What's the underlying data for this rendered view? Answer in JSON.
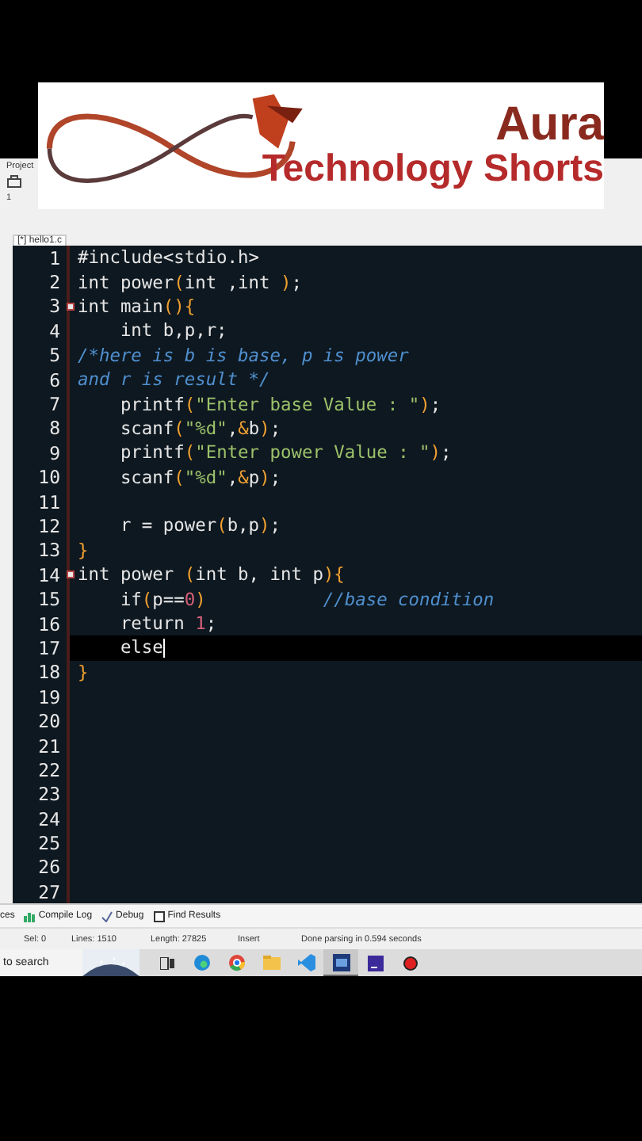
{
  "banner": {
    "title": "Aura",
    "subtitle": "Technology Shorts"
  },
  "ide": {
    "project_label": "Project",
    "panel_mark": "1",
    "file_tab": {
      "label": "[*] hello1.c",
      "selected": true
    }
  },
  "editor": {
    "lines": [
      {
        "number": "1",
        "fold": false,
        "current": false,
        "tokens": [
          {
            "kind": "plain",
            "text": "#include<stdio.h>"
          }
        ]
      },
      {
        "number": "2",
        "fold": false,
        "current": false,
        "tokens": [
          {
            "kind": "plain",
            "text": "int power"
          },
          {
            "kind": "paren",
            "text": "("
          },
          {
            "kind": "plain",
            "text": "int ,int "
          },
          {
            "kind": "paren",
            "text": ")"
          },
          {
            "kind": "plain",
            "text": ";"
          }
        ]
      },
      {
        "number": "3",
        "fold": true,
        "current": false,
        "tokens": [
          {
            "kind": "plain",
            "text": "int main"
          },
          {
            "kind": "paren",
            "text": "(){"
          }
        ]
      },
      {
        "number": "4",
        "fold": false,
        "current": false,
        "tokens": [
          {
            "kind": "plain",
            "text": "    int b,p,r;"
          }
        ]
      },
      {
        "number": "5",
        "fold": false,
        "current": false,
        "tokens": [
          {
            "kind": "comment",
            "text": "/*here is b is base, p is power"
          }
        ]
      },
      {
        "number": "6",
        "fold": false,
        "current": false,
        "tokens": [
          {
            "kind": "comment",
            "text": "and r is result */"
          }
        ]
      },
      {
        "number": "7",
        "fold": false,
        "current": false,
        "tokens": [
          {
            "kind": "plain",
            "text": "    printf"
          },
          {
            "kind": "paren",
            "text": "("
          },
          {
            "kind": "string",
            "text": "\"Enter base Value : \""
          },
          {
            "kind": "paren",
            "text": ")"
          },
          {
            "kind": "plain",
            "text": ";"
          }
        ]
      },
      {
        "number": "8",
        "fold": false,
        "current": false,
        "tokens": [
          {
            "kind": "plain",
            "text": "    scanf"
          },
          {
            "kind": "paren",
            "text": "("
          },
          {
            "kind": "string",
            "text": "\"%d\""
          },
          {
            "kind": "plain",
            "text": ","
          },
          {
            "kind": "paren",
            "text": "&"
          },
          {
            "kind": "plain",
            "text": "b"
          },
          {
            "kind": "paren",
            "text": ")"
          },
          {
            "kind": "plain",
            "text": ";"
          }
        ]
      },
      {
        "number": "9",
        "fold": false,
        "current": false,
        "tokens": [
          {
            "kind": "plain",
            "text": "    printf"
          },
          {
            "kind": "paren",
            "text": "("
          },
          {
            "kind": "string",
            "text": "\"Enter power Value : \""
          },
          {
            "kind": "paren",
            "text": ")"
          },
          {
            "kind": "plain",
            "text": ";"
          }
        ]
      },
      {
        "number": "10",
        "fold": false,
        "current": false,
        "tokens": [
          {
            "kind": "plain",
            "text": "    scanf"
          },
          {
            "kind": "paren",
            "text": "("
          },
          {
            "kind": "string",
            "text": "\"%d\""
          },
          {
            "kind": "plain",
            "text": ","
          },
          {
            "kind": "paren",
            "text": "&"
          },
          {
            "kind": "plain",
            "text": "p"
          },
          {
            "kind": "paren",
            "text": ")"
          },
          {
            "kind": "plain",
            "text": ";"
          }
        ]
      },
      {
        "number": "11",
        "fold": false,
        "current": false
      },
      {
        "number": "12",
        "fold": false,
        "current": false,
        "tokens": [
          {
            "kind": "plain",
            "text": "    r = power"
          },
          {
            "kind": "paren",
            "text": "("
          },
          {
            "kind": "plain",
            "text": "b,p"
          },
          {
            "kind": "paren",
            "text": ")"
          },
          {
            "kind": "plain",
            "text": ";"
          }
        ]
      },
      {
        "number": "13",
        "fold": false,
        "current": false,
        "tokens": [
          {
            "kind": "paren",
            "text": "}"
          }
        ]
      },
      {
        "number": "14",
        "fold": true,
        "current": false,
        "tokens": [
          {
            "kind": "plain",
            "text": "int power "
          },
          {
            "kind": "paren",
            "text": "("
          },
          {
            "kind": "plain",
            "text": "int b, int p"
          },
          {
            "kind": "paren",
            "text": "){"
          }
        ]
      },
      {
        "number": "15",
        "fold": false,
        "current": false,
        "tokens": [
          {
            "kind": "plain",
            "text": "    if"
          },
          {
            "kind": "paren",
            "text": "("
          },
          {
            "kind": "plain",
            "text": "p=="
          },
          {
            "kind": "number",
            "text": "0"
          },
          {
            "kind": "paren",
            "text": ")"
          },
          {
            "kind": "comment",
            "text": "//base condition"
          }
        ]
      },
      {
        "number": "16",
        "fold": false,
        "current": false,
        "tokens": [
          {
            "kind": "plain",
            "text": "    return "
          },
          {
            "kind": "number",
            "text": "1"
          },
          {
            "kind": "plain",
            "text": ";"
          }
        ]
      },
      {
        "number": "17",
        "fold": false,
        "current": true,
        "tokens": [
          {
            "kind": "plain",
            "text": "    else"
          }
        ]
      },
      {
        "number": "18",
        "fold": false,
        "current": false,
        "tokens": [
          {
            "kind": "paren",
            "text": "}"
          }
        ]
      },
      {
        "number": "19",
        "fold": false,
        "current": false
      },
      {
        "number": "20",
        "fold": false,
        "current": false
      },
      {
        "number": "21",
        "fold": false,
        "current": false
      },
      {
        "number": "22",
        "fold": false,
        "current": false
      },
      {
        "number": "23",
        "fold": false,
        "current": false
      },
      {
        "number": "24",
        "fold": false,
        "current": false
      },
      {
        "number": "25",
        "fold": false,
        "current": false
      },
      {
        "number": "26",
        "fold": false,
        "current": false
      },
      {
        "number": "27",
        "fold": false,
        "current": false
      }
    ]
  },
  "bottom_tabs": [
    {
      "label": "ces"
    },
    {
      "label": "Compile Log"
    },
    {
      "label": "Debug"
    },
    {
      "label": "Find Results"
    }
  ],
  "status_bar": [
    "Sel:  0",
    "Lines:  1510",
    "Length:  27825",
    "Insert",
    "Done parsing in 0.594 seconds"
  ],
  "taskbar": {
    "search": {
      "placeholder": "to search"
    },
    "apps": [
      {
        "kind": "taskview"
      },
      {
        "kind": "edge"
      },
      {
        "kind": "chrome"
      },
      {
        "kind": "folder"
      },
      {
        "kind": "vscode"
      },
      {
        "kind": "devcpp",
        "selected": true
      },
      {
        "kind": "ide"
      },
      {
        "kind": "record"
      }
    ]
  }
}
